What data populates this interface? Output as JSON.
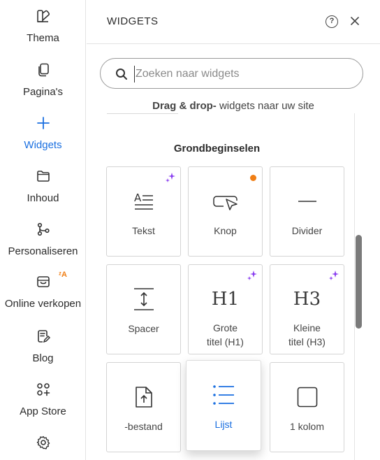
{
  "colors": {
    "accent": "#1a6fe0",
    "badge": "#f07e14",
    "sparkle": "#8a3ff0"
  },
  "rail": {
    "items": [
      {
        "label": "Thema",
        "icon": "theme-icon"
      },
      {
        "label": "Pagina's",
        "icon": "pages-icon"
      },
      {
        "label": "Widgets",
        "icon": "plus-icon",
        "active": true
      },
      {
        "label": "Inhoud",
        "icon": "folder-icon"
      },
      {
        "label": "Personaliseren",
        "icon": "branch-icon"
      },
      {
        "label": "Online verkopen",
        "icon": "shop-icon"
      },
      {
        "label": "Blog",
        "icon": "blog-icon"
      },
      {
        "label": "App Store",
        "icon": "apps-icon"
      },
      {
        "label": "",
        "icon": "gear-icon"
      }
    ]
  },
  "panel": {
    "title": "WIDGETS",
    "help": "?",
    "close": "✕",
    "search_placeholder": "Zoeken naar widgets",
    "hint_bold": "Drag & drop-",
    "hint_rest": " widgets naar uw site",
    "section": "Grondbeginselen",
    "tiles": [
      {
        "label": "Tekst",
        "icon": "text-icon",
        "badge": "sparkle"
      },
      {
        "label": "Knop",
        "icon": "button-icon",
        "badge": "dot"
      },
      {
        "label": "Divider",
        "icon": "divider-icon",
        "badge": ""
      },
      {
        "label": "Spacer",
        "icon": "spacer-icon",
        "badge": ""
      },
      {
        "label": "Grote\ntitel (H1)",
        "icon": "h1-icon",
        "glyph": "H1",
        "badge": "sparkle"
      },
      {
        "label": "Kleine\ntitel (H3)",
        "icon": "h3-icon",
        "glyph": "H3",
        "badge": "sparkle"
      },
      {
        "label": "-bestand",
        "icon": "file-upload-icon",
        "badge": ""
      },
      {
        "label": "Lijst",
        "icon": "list-icon",
        "badge": "",
        "hover": true
      },
      {
        "label": "1 kolom",
        "icon": "column-icon",
        "badge": ""
      }
    ]
  }
}
